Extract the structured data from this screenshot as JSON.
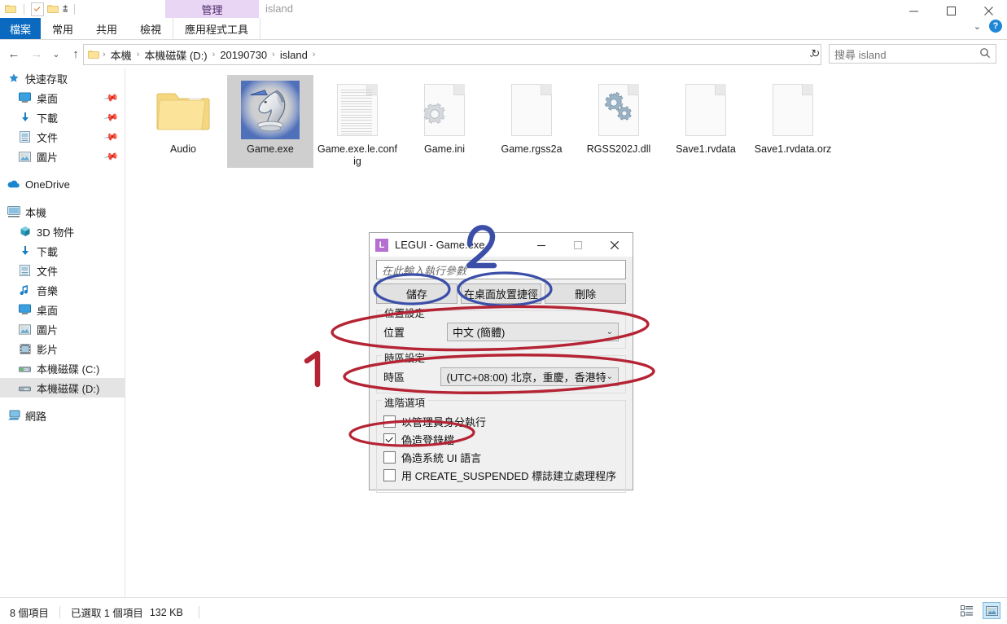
{
  "window": {
    "title": "island",
    "quick_access": [
      "folder-icon",
      "properties-icon",
      "new-folder-icon",
      "more-caret-icon"
    ],
    "contextual_tab_group": "管理",
    "controls": {
      "minimize": "—",
      "maximize": "□",
      "close": "✕"
    }
  },
  "ribbon": {
    "tabs": [
      {
        "label": "檔案",
        "kind": "file"
      },
      {
        "label": "常用",
        "kind": "normal"
      },
      {
        "label": "共用",
        "kind": "normal"
      },
      {
        "label": "檢視",
        "kind": "normal"
      },
      {
        "label": "應用程式工具",
        "kind": "contextual"
      }
    ],
    "collapse_caret": "⌄",
    "help_label": "?"
  },
  "address": {
    "back": "←",
    "forward": "→",
    "history": "⌄",
    "up": "↑",
    "breadcrumb": [
      "本機",
      "本機磁碟 (D:)",
      "20190730",
      "island"
    ],
    "separator": "›",
    "dropdown_caret": "⌄",
    "refresh": "↻"
  },
  "search": {
    "placeholder": "搜尋 island",
    "icon": "search-icon"
  },
  "sidebar": {
    "items": [
      {
        "label": "快速存取",
        "icon": "star-icon",
        "level": 0,
        "pinned": false,
        "selected": false
      },
      {
        "label": "桌面",
        "icon": "desktop-icon",
        "level": 1,
        "pinned": true,
        "selected": false
      },
      {
        "label": "下載",
        "icon": "download-icon",
        "level": 1,
        "pinned": true,
        "selected": false
      },
      {
        "label": "文件",
        "icon": "documents-icon",
        "level": 1,
        "pinned": true,
        "selected": false
      },
      {
        "label": "圖片",
        "icon": "pictures-icon",
        "level": 1,
        "pinned": true,
        "selected": false
      },
      {
        "label": "OneDrive",
        "icon": "onedrive-icon",
        "level": 0,
        "pinned": false,
        "selected": false,
        "gap_before": true
      },
      {
        "label": "本機",
        "icon": "thispc-icon",
        "level": 0,
        "pinned": false,
        "selected": false,
        "gap_before": true
      },
      {
        "label": "3D 物件",
        "icon": "3dobjects-icon",
        "level": 1,
        "pinned": false,
        "selected": false
      },
      {
        "label": "下載",
        "icon": "download-icon",
        "level": 1,
        "pinned": false,
        "selected": false
      },
      {
        "label": "文件",
        "icon": "documents-icon",
        "level": 1,
        "pinned": false,
        "selected": false
      },
      {
        "label": "音樂",
        "icon": "music-icon",
        "level": 1,
        "pinned": false,
        "selected": false
      },
      {
        "label": "桌面",
        "icon": "desktop-icon",
        "level": 1,
        "pinned": false,
        "selected": false
      },
      {
        "label": "圖片",
        "icon": "pictures-icon",
        "level": 1,
        "pinned": false,
        "selected": false
      },
      {
        "label": "影片",
        "icon": "videos-icon",
        "level": 1,
        "pinned": false,
        "selected": false
      },
      {
        "label": "本機磁碟 (C:)",
        "icon": "drive-c-icon",
        "level": 1,
        "pinned": false,
        "selected": false
      },
      {
        "label": "本機磁碟 (D:)",
        "icon": "drive-d-icon",
        "level": 1,
        "pinned": false,
        "selected": true
      },
      {
        "label": "網路",
        "icon": "network-icon",
        "level": 0,
        "pinned": false,
        "selected": false,
        "gap_before": true
      }
    ]
  },
  "files": [
    {
      "name": "Audio",
      "icon": "folder-icon",
      "selected": false
    },
    {
      "name": "Game.exe",
      "icon": "knight-chess-icon",
      "selected": true
    },
    {
      "name": "Game.exe.le.config",
      "icon": "text-document-icon",
      "selected": false
    },
    {
      "name": "Game.ini",
      "icon": "ini-settings-icon",
      "selected": false
    },
    {
      "name": "Game.rgss2a",
      "icon": "blank-document-icon",
      "selected": false
    },
    {
      "name": "RGSS202J.dll",
      "icon": "dll-gears-icon",
      "selected": false
    },
    {
      "name": "Save1.rvdata",
      "icon": "blank-document-icon",
      "selected": false
    },
    {
      "name": "Save1.rvdata.orz",
      "icon": "blank-document-icon",
      "selected": false
    }
  ],
  "statusbar": {
    "item_count": "8 個項目",
    "selection": "已選取 1 個項目",
    "size": "132 KB",
    "views": [
      {
        "name": "details-view-button",
        "active": false
      },
      {
        "name": "large-icons-view-button",
        "active": true
      }
    ]
  },
  "dialog": {
    "title": "LEGUI - Game.exe",
    "icon_letter": "L",
    "controls": {
      "minimize": "—",
      "maximize": "□",
      "close": "✕"
    },
    "param_placeholder": "在此輸入執行參數",
    "buttons": [
      {
        "label": "儲存",
        "name": "save-button"
      },
      {
        "label": "在桌面放置捷徑",
        "name": "create-desktop-shortcut-button"
      },
      {
        "label": "刪除",
        "name": "delete-button"
      }
    ],
    "locale_group": {
      "title": "位置設定",
      "field_label": "位置",
      "value": "中文 (簡體)"
    },
    "timezone_group": {
      "title": "時區設定",
      "field_label": "時區",
      "value": "(UTC+08:00) 北京，重慶，香港特"
    },
    "advanced_group": {
      "title": "進階選項",
      "checkboxes": [
        {
          "label": "以管理員身分執行",
          "checked": false,
          "name": "run-as-admin-checkbox"
        },
        {
          "label": "偽造登錄檔",
          "checked": true,
          "name": "fake-registry-checkbox"
        },
        {
          "label": "偽造系統 UI 語言",
          "checked": false,
          "name": "fake-ui-language-checkbox"
        },
        {
          "label": "用 CREATE_SUSPENDED 標誌建立處理程序",
          "checked": false,
          "name": "create-suspended-checkbox"
        }
      ]
    }
  },
  "annotations": {
    "marker_one": "1",
    "marker_two": "2",
    "red_color": "#b52435",
    "blue_color": "#3b4fa8"
  }
}
